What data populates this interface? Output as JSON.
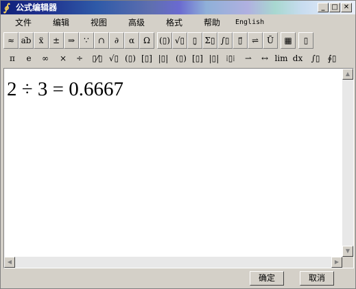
{
  "window": {
    "title": "公式编辑器"
  },
  "title_buttons": [
    {
      "glyph": "_",
      "icon": "minimize-icon"
    },
    {
      "glyph": "□",
      "icon": "maximize-icon"
    },
    {
      "glyph": "✕",
      "icon": "close-icon"
    }
  ],
  "menu": {
    "items": [
      "文件",
      "编辑",
      "视图",
      "高级",
      "格式",
      "帮助",
      "English"
    ]
  },
  "toolbar_top": [
    {
      "glyph": "≈",
      "icon": "relations-palette-icon"
    },
    {
      "glyph": "a͘b",
      "icon": "spaces-ellipses-palette-icon"
    },
    {
      "glyph": "ẍ",
      "icon": "embellishments-palette-icon"
    },
    {
      "glyph": "±",
      "icon": "operators-palette-icon"
    },
    {
      "glyph": "⇒",
      "icon": "arrows-palette-icon"
    },
    {
      "glyph": "∵",
      "icon": "logical-palette-icon"
    },
    {
      "glyph": "∩",
      "icon": "set-theory-palette-icon"
    },
    {
      "glyph": "∂",
      "icon": "misc-symbols-palette-icon"
    },
    {
      "glyph": "α",
      "icon": "greek-lower-palette-icon"
    },
    {
      "glyph": "Ω",
      "icon": "greek-upper-palette-icon"
    },
    {
      "glyph": "(▯)",
      "icon": "fences-template-icon"
    },
    {
      "glyph": "√▯",
      "icon": "fraction-radical-template-icon"
    },
    {
      "glyph": "▯̣",
      "icon": "subscript-superscript-template-icon"
    },
    {
      "glyph": "Σ▯",
      "icon": "summation-template-icon"
    },
    {
      "glyph": "∫▯",
      "icon": "integral-template-icon"
    },
    {
      "glyph": "▯⃗",
      "icon": "underbar-overbar-template-icon"
    },
    {
      "glyph": "⇌",
      "icon": "labeled-arrow-template-icon"
    },
    {
      "glyph": "Ū",
      "icon": "products-set-template-icon"
    },
    {
      "glyph": "▦",
      "icon": "matrix-template-icon"
    },
    {
      "glyph": "▯",
      "icon": "more-templates-icon"
    }
  ],
  "toolbar_bottom": [
    {
      "glyph": "π",
      "icon": "pi-icon"
    },
    {
      "glyph": "e",
      "icon": "e-icon"
    },
    {
      "glyph": "∞",
      "icon": "infinity-icon"
    },
    {
      "glyph": "×",
      "icon": "times-icon"
    },
    {
      "glyph": "÷",
      "icon": "divide-icon"
    },
    {
      "glyph": "▯⁄▯",
      "icon": "fraction-icon"
    },
    {
      "glyph": "√▯",
      "icon": "sqrt-icon"
    },
    {
      "glyph": "(▯)",
      "icon": "parentheses-icon"
    },
    {
      "glyph": "[▯]",
      "icon": "brackets-icon"
    },
    {
      "glyph": "|▯|",
      "icon": "absolute-value-icon"
    },
    {
      "glyph": "(▯)",
      "icon": "paren-matrix-icon"
    },
    {
      "glyph": "[▯]",
      "icon": "bracket-matrix-icon"
    },
    {
      "glyph": "|▯|",
      "icon": "determinant-icon"
    },
    {
      "glyph": "⁞▯⁞",
      "icon": "matrix-box-icon"
    },
    {
      "glyph": "⇀",
      "icon": "right-harpoon-icon"
    },
    {
      "glyph": "↔",
      "icon": "left-right-arrow-icon"
    },
    {
      "glyph": "lim",
      "icon": "limit-icon"
    },
    {
      "glyph": "dx",
      "icon": "differential-icon"
    },
    {
      "glyph": "∫▯",
      "icon": "integral-icon"
    },
    {
      "glyph": "∮▯",
      "icon": "contour-integral-icon"
    }
  ],
  "equation": "2 ÷ 3 = 0.6667",
  "scroll": {
    "up": "▲",
    "down": "▼",
    "left": "◀",
    "right": "▶"
  },
  "buttons": {
    "ok": "确定",
    "cancel": "取消"
  }
}
